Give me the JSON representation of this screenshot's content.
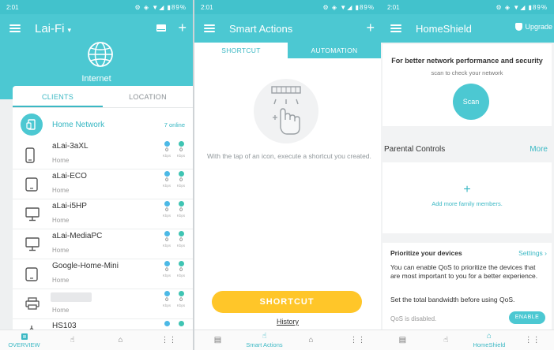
{
  "panel1": {
    "status": {
      "time": "2:01",
      "battery": "89%"
    },
    "appbar": {
      "title": "Lai-Fi",
      "caret": "▾"
    },
    "internet_label": "Internet",
    "tabs": [
      "CLIENTS",
      "LOCATION"
    ],
    "home_network": {
      "label": "Home Network",
      "online": "7 online"
    },
    "clients": [
      {
        "name": "aLai-3aXL",
        "sub": "Home",
        "device": "phone",
        "up": "0",
        "down": "0",
        "unit": "Kbps"
      },
      {
        "name": "aLai-ECO",
        "sub": "Home",
        "device": "tablet",
        "up": "0",
        "down": "0",
        "unit": "Kbps"
      },
      {
        "name": "aLai-i5HP",
        "sub": "Home",
        "device": "desktop",
        "up": "0",
        "down": "0",
        "unit": "Kbps"
      },
      {
        "name": "aLai-MediaPC",
        "sub": "Home",
        "device": "desktop",
        "up": "0",
        "down": "0",
        "unit": "Kbps"
      },
      {
        "name": "Google-Home-Mini",
        "sub": "Home",
        "device": "tablet",
        "up": "0",
        "down": "0",
        "unit": "Kbps"
      },
      {
        "name": "",
        "sub": "Home",
        "device": "printer",
        "up": "0",
        "down": "0",
        "unit": "Kbps"
      },
      {
        "name": "HS103",
        "sub": "",
        "device": "plug",
        "up": "",
        "down": "",
        "unit": ""
      }
    ],
    "nav": {
      "overview": "OVERVIEW"
    }
  },
  "panel2": {
    "status": {
      "time": "2:01",
      "battery": "89%"
    },
    "appbar": {
      "title": "Smart Actions"
    },
    "tabs": [
      "SHORTCUT",
      "AUTOMATION"
    ],
    "hint": "With the tap of an icon, execute a shortcut you created.",
    "shortcut_button": "SHORTCUT",
    "history_link": "History",
    "nav": {
      "smart_actions": "Smart Actions"
    }
  },
  "panel3": {
    "status": {
      "time": "2:01",
      "battery": "89%"
    },
    "appbar": {
      "title": "HomeShield",
      "upgrade": "Upgrade"
    },
    "scan": {
      "title": "For better network performance and security",
      "subtitle": "scan to check your network",
      "button": "Scan"
    },
    "parental": {
      "title": "Parental Controls",
      "more": "More",
      "add_plus": "+",
      "add_label": "Add more family members."
    },
    "qos": {
      "title": "Prioritize your devices",
      "settings": "Settings ›",
      "desc": "You can enable QoS to prioritize the devices that are most important to you for a better experience.",
      "bandwidth": "Set the total bandwidth before using QoS.",
      "disabled": "QoS is disabled.",
      "enable": "ENABLE"
    },
    "nav": {
      "homeshield": "HomeShield"
    }
  },
  "colors": {
    "accent": "#4cc8d2",
    "shortcut": "#ffc629",
    "upload_dot": "#4cb9e6",
    "download_dot": "#3fc4b3"
  }
}
